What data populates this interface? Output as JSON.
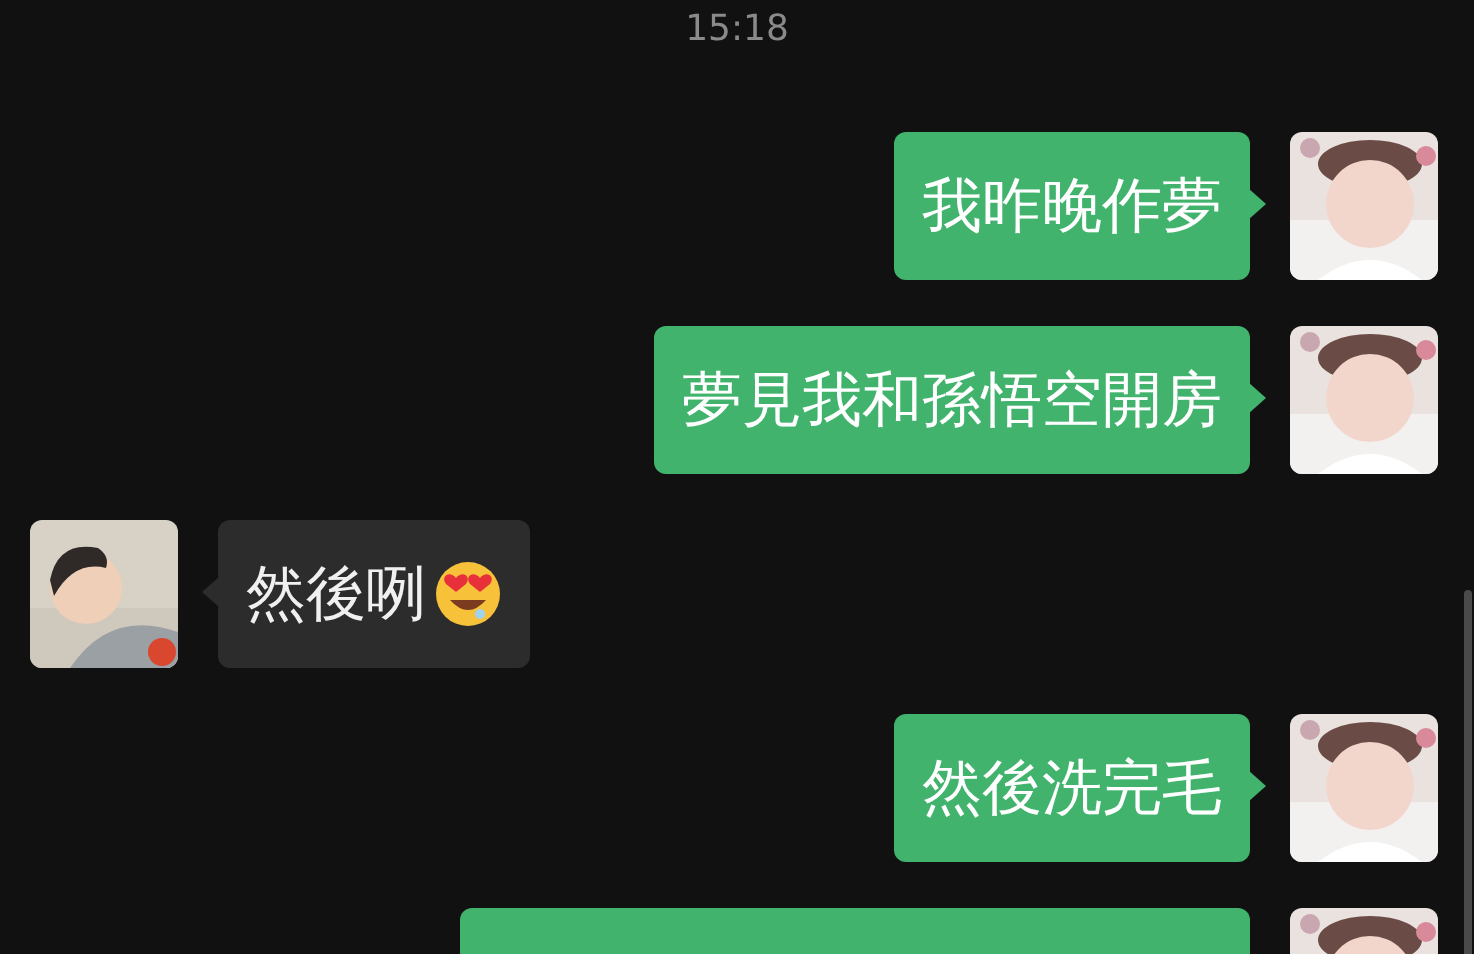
{
  "timestamp": "15:18",
  "messages": [
    {
      "outgoing": true,
      "text": "我昨晚作夢"
    },
    {
      "outgoing": true,
      "text": "夢見我和孫悟空開房"
    },
    {
      "outgoing": false,
      "text": "然後咧",
      "emoji": true
    },
    {
      "outgoing": true,
      "text": "然後洗完毛"
    },
    {
      "outgoing": true,
      "kind": "cut"
    }
  ]
}
